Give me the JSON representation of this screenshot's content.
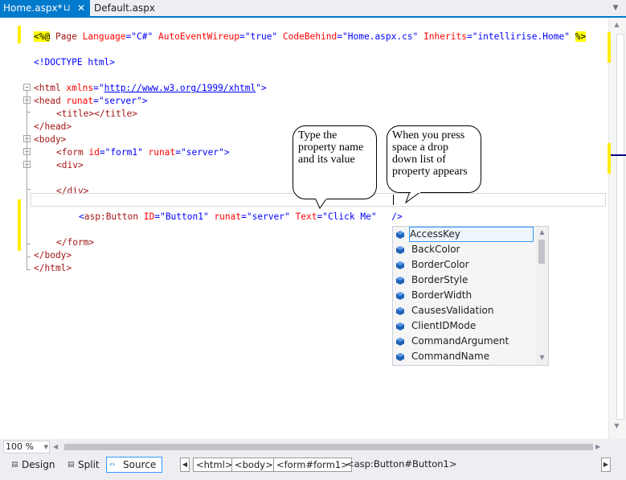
{
  "tabs": [
    {
      "label": "Home.aspx*",
      "active": true,
      "pin_icon": "pin-icon",
      "close_icon": "close-icon"
    },
    {
      "label": "Default.aspx",
      "active": false
    }
  ],
  "code_lines": {
    "l1": {
      "open": "<%@",
      "directive": " Page",
      "attrs": [
        {
          "name": " Language",
          "eq": "=",
          "value": "\"C#\""
        },
        {
          "name": " AutoEventWireup",
          "eq": "=",
          "value": "\"true\""
        },
        {
          "name": " CodeBehind",
          "eq": "=",
          "value": "\"Home.aspx.cs\""
        },
        {
          "name": " Inherits",
          "eq": "=",
          "value": "\"intellirise.Home\""
        }
      ],
      "close": "%>"
    },
    "l3": "<!DOCTYPE html>",
    "l5": {
      "tag": "<html",
      "attr": " xmlns",
      "eq": "=",
      "quote_open": "\"",
      "url": "http://www.w3.org/1999/xhtml",
      "quote_close": "\"",
      "end": ">"
    },
    "l6": {
      "tag": "<head",
      "attr": " runat",
      "eq": "=",
      "value": "\"server\"",
      "end": ">"
    },
    "l7": {
      "open": "<title></title>"
    },
    "l8": "</head>",
    "l9": "<body>",
    "l10": {
      "tag": "<form",
      "attr1": " id",
      "eq1": "=",
      "val1": "\"form1\"",
      "attr2": " runat",
      "eq2": "=",
      "val2": "\"server\"",
      "end": ">"
    },
    "l11": "<div>",
    "l13": "</div>",
    "l15": {
      "lt": "<",
      "tag": "asp:Button",
      "a1": " ID",
      "e1": "=",
      "v1": "\"Button1\"",
      "a2": " runat",
      "e2": "=",
      "v2": "\"server\"",
      "a3": " Text",
      "e3": "=",
      "v3": "\"Click Me\"",
      "end": " />"
    },
    "l17": "</form>",
    "l18": "</body>",
    "l19": "</html>"
  },
  "callouts": [
    {
      "text": "Type the property name and its value"
    },
    {
      "text": "When you press space a drop down list of property appears"
    }
  ],
  "completion": {
    "selected": "AccessKey",
    "items": [
      "AccessKey",
      "BackColor",
      "BorderColor",
      "BorderStyle",
      "BorderWidth",
      "CausesValidation",
      "ClientIDMode",
      "CommandArgument",
      "CommandName"
    ],
    "item_icon": "property-icon"
  },
  "zoom": {
    "value": "100 %"
  },
  "views": {
    "design": "Design",
    "split": "Split",
    "source": "Source",
    "active": "Source"
  },
  "breadcrumbs": [
    "<html>",
    "<body>",
    "<form#form1>",
    "<asp:Button#Button1>"
  ],
  "colors": {
    "accent": "#007acc",
    "change_bar": "#ffee00",
    "tag": "#a31515",
    "attr": "#ff0000",
    "value": "#0000ff"
  }
}
